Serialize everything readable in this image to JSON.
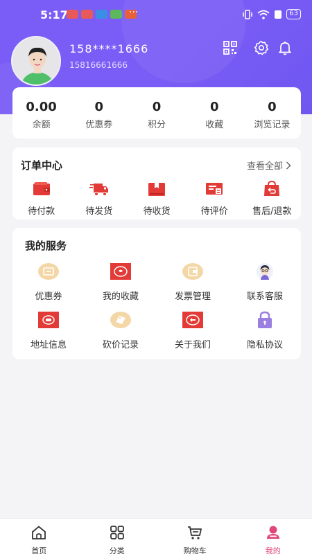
{
  "status_bar": {
    "time": "5:17",
    "dots": "···",
    "battery": "63"
  },
  "user": {
    "name": "158****1666",
    "phone": "15816661666"
  },
  "stats": [
    {
      "value": "0.00",
      "label": "余额"
    },
    {
      "value": "0",
      "label": "优惠券"
    },
    {
      "value": "0",
      "label": "积分"
    },
    {
      "value": "0",
      "label": "收藏"
    },
    {
      "value": "0",
      "label": "浏览记录"
    }
  ],
  "orders": {
    "title": "订单中心",
    "view_all": "查看全部",
    "items": [
      {
        "label": "待付款",
        "icon": "wallet-icon"
      },
      {
        "label": "待发货",
        "icon": "truck-icon"
      },
      {
        "label": "待收货",
        "icon": "box-icon"
      },
      {
        "label": "待评价",
        "icon": "comment-icon"
      },
      {
        "label": "售后/退款",
        "icon": "refund-bag-icon"
      }
    ]
  },
  "services": {
    "title": "我的服务",
    "items": [
      {
        "label": "优惠券",
        "icon": "coupon-icon"
      },
      {
        "label": "我的收藏",
        "icon": "favorite-icon"
      },
      {
        "label": "发票管理",
        "icon": "invoice-icon"
      },
      {
        "label": "联系客服",
        "icon": "customer-service-icon"
      },
      {
        "label": "地址信息",
        "icon": "address-icon"
      },
      {
        "label": "砍价记录",
        "icon": "bargain-icon"
      },
      {
        "label": "关于我们",
        "icon": "about-icon"
      },
      {
        "label": "隐私协议",
        "icon": "lock-icon"
      }
    ]
  },
  "tabbar": [
    {
      "label": "首页",
      "icon": "home-icon"
    },
    {
      "label": "分类",
      "icon": "category-icon"
    },
    {
      "label": "购物车",
      "icon": "cart-icon"
    },
    {
      "label": "我的",
      "icon": "profile-icon",
      "active": true
    }
  ],
  "colors": {
    "header": "#7a5cf6",
    "accent_red": "#e23a36",
    "active_tab": "#e0467c"
  }
}
